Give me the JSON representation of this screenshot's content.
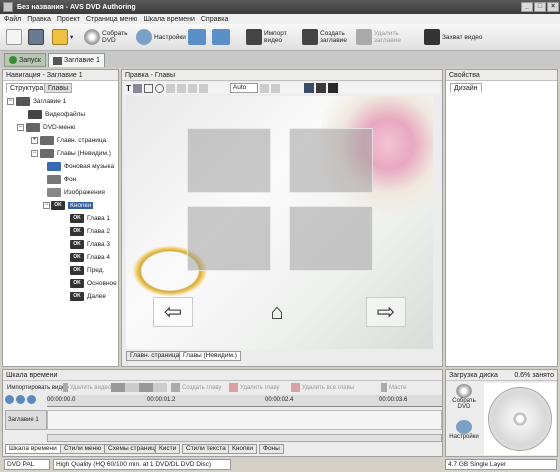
{
  "window": {
    "title": "Без названия - AVS DVD Authoring",
    "minimize": "_",
    "maximize": "□",
    "close": "×"
  },
  "menu": [
    "Файл",
    "Правка",
    "Проект",
    "Страница меню",
    "Шкала времени",
    "Справка"
  ],
  "toolbar": {
    "build_dvd": "Собрать DVD",
    "settings": "Настройки",
    "import_video": "Импорт видео",
    "create_title": "Создать заглавие",
    "delete_title": "Удалить заглавие",
    "capture_video": "Захват видео"
  },
  "project_tabs": [
    "Запуск",
    "Заглавие 1"
  ],
  "navigation": {
    "header": "Навигация - Заглавие 1",
    "tabs": [
      "Структура",
      "Главы"
    ],
    "tree": [
      "Заглавие 1",
      "Видеофайлы",
      "DVD-меню",
      "Главн. страница",
      "Главы (Невидим.)",
      "Фоновая музыка",
      "Фон",
      "Изображения",
      "Кнопки",
      "Глава 1",
      "Глава 2",
      "Глава 3",
      "Глава 4",
      "Пред.",
      "Основное",
      "Далее"
    ],
    "ok_label": "OK"
  },
  "editor": {
    "header": "Правка - Главы",
    "zoom_value": "Auto",
    "page_tabs": [
      "Главн. страница",
      "Главы (Невидим.)"
    ]
  },
  "properties": {
    "header": "Свойства",
    "tab": "Дизайн"
  },
  "timeline": {
    "header": "Шкала времени",
    "import_video": "Импортировать видео",
    "delete_video": "Удалить видео",
    "create_chapter": "Создать главу",
    "delete_chapter": "Удалить главу",
    "delete_all_chapters": "Удалить все главы",
    "master": "Масте",
    "times": [
      "00:00:00.0",
      "00:00:01.2",
      "00:00:02.4",
      "00:00:03.6"
    ],
    "track_label": "Заглавие 1",
    "bottom_tabs": [
      "Шкала времени",
      "Стили меню",
      "Схемы страниц",
      "Кисти",
      "Стили текста",
      "Кнопки",
      "Фоны"
    ]
  },
  "disc": {
    "header": "Загрузка диска",
    "used": "0.6% занято",
    "build_dvd": "Собрать DVD",
    "settings": "Настройки"
  },
  "status": {
    "format": "DVD PAL",
    "quality": "High Quality (HQ 60/100 min. at 1 DVD/DL DVD Disc)",
    "disc_type": "4.7 GB Single Layer"
  },
  "colors": {
    "accent": "#4a6a9a",
    "titlebar": "#3a3a3a",
    "selected": "#3060a0",
    "ok_badge": "#333333"
  }
}
